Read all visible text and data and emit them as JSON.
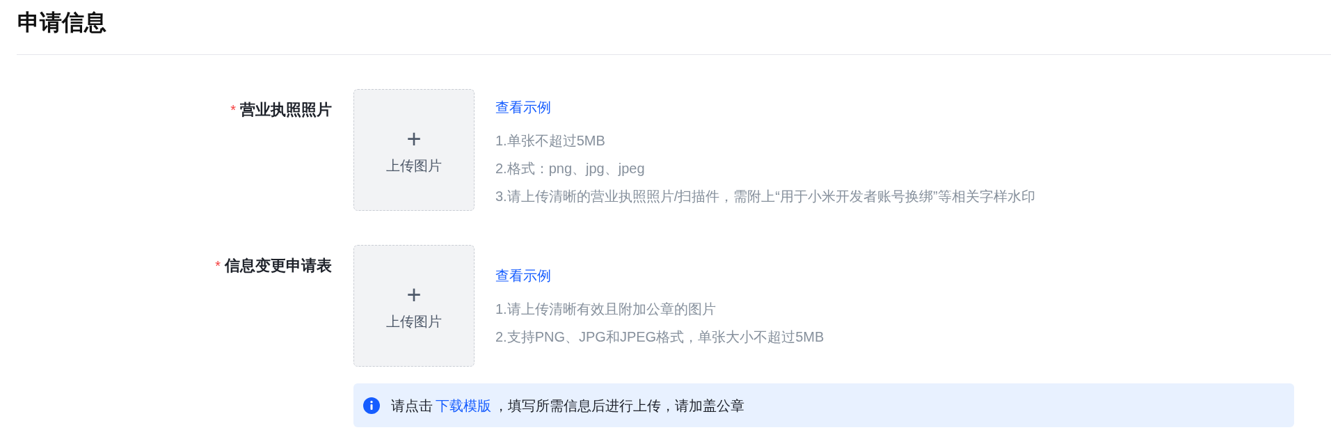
{
  "title": "申请信息",
  "fields": [
    {
      "label": "营业执照照片",
      "required_mark": "*",
      "upload_label": "上传图片",
      "plus": "+",
      "example_link": "查看示例",
      "hints": [
        "1.单张不超过5MB",
        "2.格式：png、jpg、jpeg",
        "3.请上传清晰的营业执照照片/扫描件，需附上“用于小米开发者账号换绑”等相关字样水印"
      ]
    },
    {
      "label": "信息变更申请表",
      "required_mark": "*",
      "upload_label": "上传图片",
      "plus": "+",
      "example_link": "查看示例",
      "hints": [
        "1.请上传清晰有效且附加公章的图片",
        "2.支持PNG、JPG和JPEG格式，单张大小不超过5MB"
      ]
    }
  ],
  "notice": {
    "before": "请点击",
    "link": "下载模版",
    "after": "，填写所需信息后进行上传，请加盖公章"
  }
}
